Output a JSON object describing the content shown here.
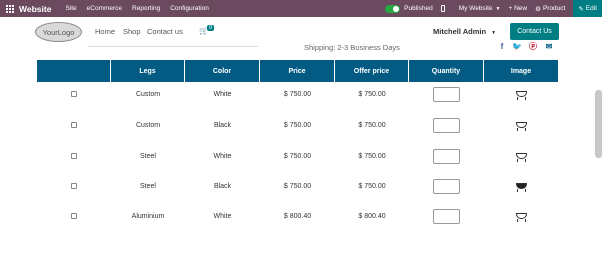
{
  "admin_bar": {
    "brand": "Website",
    "menus": [
      "Site",
      "eCommerce",
      "Reporting",
      "Configuration"
    ],
    "published_label": "Published",
    "website_selector": "My Website",
    "new_label": "+ New",
    "product_label": "Product",
    "edit_label": "Edit"
  },
  "header": {
    "logo_text": "YourLogo",
    "nav": [
      "Home",
      "Shop",
      "Contact us"
    ],
    "cart_count": "0",
    "user_name": "Mitchell Admin",
    "contact_button": "Contact Us"
  },
  "shipping_text": "Shipping: 2-3 Business Days",
  "social_icons": [
    "facebook-icon",
    "twitter-icon",
    "pinterest-icon",
    "email-icon"
  ],
  "colors": {
    "admin_bar": "#6b4a60",
    "accent": "#017e84",
    "table_header": "#035a83"
  },
  "table": {
    "headers": [
      "",
      "Legs",
      "Color",
      "Price",
      "Offer price",
      "Quantity",
      "Image"
    ],
    "rows": [
      {
        "legs": "Custom",
        "color": "White",
        "price": "$ 750.00",
        "offer_price": "$ 750.00",
        "image": "tub-white"
      },
      {
        "legs": "Custom",
        "color": "Black",
        "price": "$ 750.00",
        "offer_price": "$ 750.00",
        "image": "tub-white"
      },
      {
        "legs": "Steel",
        "color": "White",
        "price": "$ 750.00",
        "offer_price": "$ 750.00",
        "image": "tub-white"
      },
      {
        "legs": "Steel",
        "color": "Black",
        "price": "$ 750.00",
        "offer_price": "$ 750.00",
        "image": "tub-black"
      },
      {
        "legs": "Aluminium",
        "color": "White",
        "price": "$ 800.40",
        "offer_price": "$ 800.40",
        "image": "tub-white"
      }
    ]
  }
}
